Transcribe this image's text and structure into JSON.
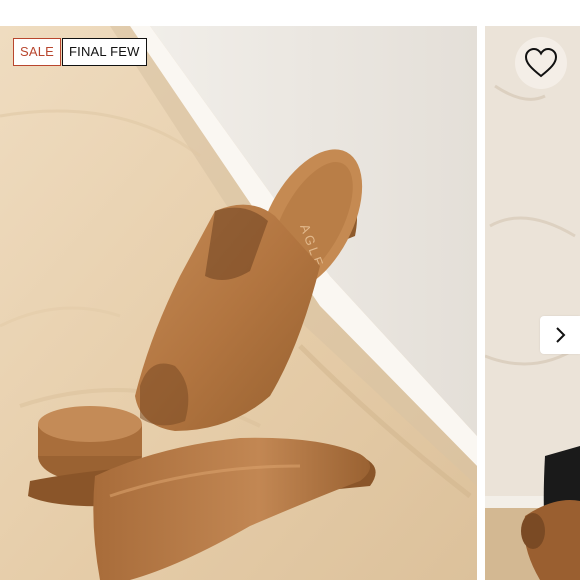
{
  "badges": {
    "sale": "SALE",
    "final_few": "FINAL FEW"
  },
  "product_image": {
    "brand_mark": "AGLE"
  },
  "icons": {
    "wishlist": "heart-outline-icon",
    "next": "chevron-right-icon"
  },
  "colors": {
    "sale_accent": "#b8462e",
    "wishlist_bg": "#f4eee7",
    "leather": "#b67a45"
  }
}
